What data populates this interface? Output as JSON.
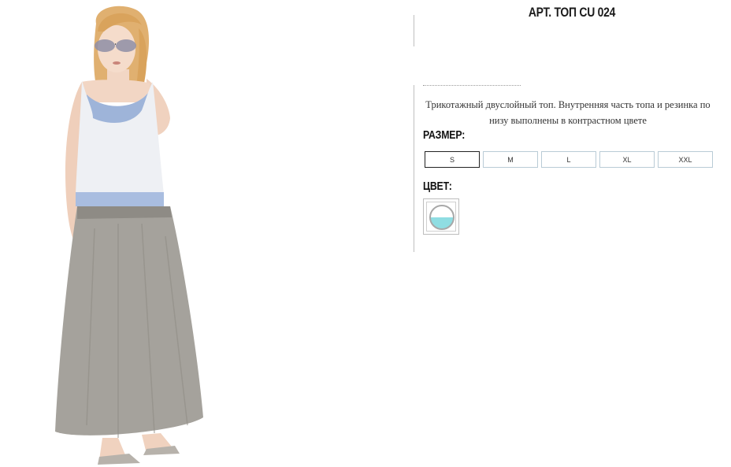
{
  "product": {
    "title": "АРТ. ТОП CU 024",
    "description": "Трикотажный двуслойный топ. Внутренняя часть топа и резинка по низу выполнены в контрастном цвете",
    "image_icon": "product-photo"
  },
  "size_section": {
    "label": "РАЗМЕР:",
    "options": [
      "S",
      "M",
      "L",
      "XL",
      "XXL"
    ],
    "selected": "S"
  },
  "color_section": {
    "label": "ЦВЕТ:",
    "swatch": {
      "icon": "color-swatch-icon",
      "top_color": "#ffffff",
      "bottom_color": "#8fdde2",
      "ring_color": "#a8a8a8"
    }
  }
}
